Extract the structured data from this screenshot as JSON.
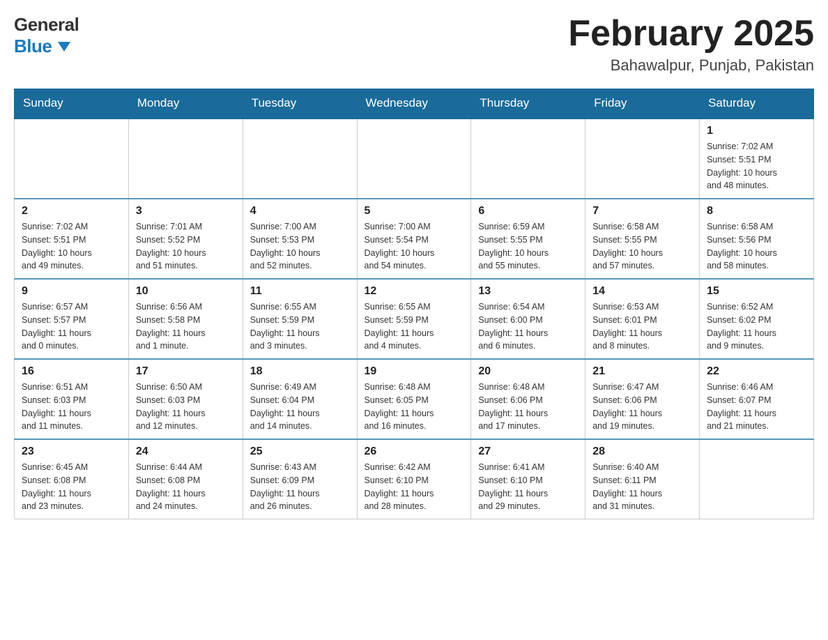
{
  "header": {
    "logo_general": "General",
    "logo_blue": "Blue",
    "month_title": "February 2025",
    "location": "Bahawalpur, Punjab, Pakistan"
  },
  "weekdays": [
    "Sunday",
    "Monday",
    "Tuesday",
    "Wednesday",
    "Thursday",
    "Friday",
    "Saturday"
  ],
  "weeks": [
    {
      "days": [
        {
          "number": "",
          "info": ""
        },
        {
          "number": "",
          "info": ""
        },
        {
          "number": "",
          "info": ""
        },
        {
          "number": "",
          "info": ""
        },
        {
          "number": "",
          "info": ""
        },
        {
          "number": "",
          "info": ""
        },
        {
          "number": "1",
          "info": "Sunrise: 7:02 AM\nSunset: 5:51 PM\nDaylight: 10 hours\nand 48 minutes."
        }
      ]
    },
    {
      "days": [
        {
          "number": "2",
          "info": "Sunrise: 7:02 AM\nSunset: 5:51 PM\nDaylight: 10 hours\nand 49 minutes."
        },
        {
          "number": "3",
          "info": "Sunrise: 7:01 AM\nSunset: 5:52 PM\nDaylight: 10 hours\nand 51 minutes."
        },
        {
          "number": "4",
          "info": "Sunrise: 7:00 AM\nSunset: 5:53 PM\nDaylight: 10 hours\nand 52 minutes."
        },
        {
          "number": "5",
          "info": "Sunrise: 7:00 AM\nSunset: 5:54 PM\nDaylight: 10 hours\nand 54 minutes."
        },
        {
          "number": "6",
          "info": "Sunrise: 6:59 AM\nSunset: 5:55 PM\nDaylight: 10 hours\nand 55 minutes."
        },
        {
          "number": "7",
          "info": "Sunrise: 6:58 AM\nSunset: 5:55 PM\nDaylight: 10 hours\nand 57 minutes."
        },
        {
          "number": "8",
          "info": "Sunrise: 6:58 AM\nSunset: 5:56 PM\nDaylight: 10 hours\nand 58 minutes."
        }
      ]
    },
    {
      "days": [
        {
          "number": "9",
          "info": "Sunrise: 6:57 AM\nSunset: 5:57 PM\nDaylight: 11 hours\nand 0 minutes."
        },
        {
          "number": "10",
          "info": "Sunrise: 6:56 AM\nSunset: 5:58 PM\nDaylight: 11 hours\nand 1 minute."
        },
        {
          "number": "11",
          "info": "Sunrise: 6:55 AM\nSunset: 5:59 PM\nDaylight: 11 hours\nand 3 minutes."
        },
        {
          "number": "12",
          "info": "Sunrise: 6:55 AM\nSunset: 5:59 PM\nDaylight: 11 hours\nand 4 minutes."
        },
        {
          "number": "13",
          "info": "Sunrise: 6:54 AM\nSunset: 6:00 PM\nDaylight: 11 hours\nand 6 minutes."
        },
        {
          "number": "14",
          "info": "Sunrise: 6:53 AM\nSunset: 6:01 PM\nDaylight: 11 hours\nand 8 minutes."
        },
        {
          "number": "15",
          "info": "Sunrise: 6:52 AM\nSunset: 6:02 PM\nDaylight: 11 hours\nand 9 minutes."
        }
      ]
    },
    {
      "days": [
        {
          "number": "16",
          "info": "Sunrise: 6:51 AM\nSunset: 6:03 PM\nDaylight: 11 hours\nand 11 minutes."
        },
        {
          "number": "17",
          "info": "Sunrise: 6:50 AM\nSunset: 6:03 PM\nDaylight: 11 hours\nand 12 minutes."
        },
        {
          "number": "18",
          "info": "Sunrise: 6:49 AM\nSunset: 6:04 PM\nDaylight: 11 hours\nand 14 minutes."
        },
        {
          "number": "19",
          "info": "Sunrise: 6:48 AM\nSunset: 6:05 PM\nDaylight: 11 hours\nand 16 minutes."
        },
        {
          "number": "20",
          "info": "Sunrise: 6:48 AM\nSunset: 6:06 PM\nDaylight: 11 hours\nand 17 minutes."
        },
        {
          "number": "21",
          "info": "Sunrise: 6:47 AM\nSunset: 6:06 PM\nDaylight: 11 hours\nand 19 minutes."
        },
        {
          "number": "22",
          "info": "Sunrise: 6:46 AM\nSunset: 6:07 PM\nDaylight: 11 hours\nand 21 minutes."
        }
      ]
    },
    {
      "days": [
        {
          "number": "23",
          "info": "Sunrise: 6:45 AM\nSunset: 6:08 PM\nDaylight: 11 hours\nand 23 minutes."
        },
        {
          "number": "24",
          "info": "Sunrise: 6:44 AM\nSunset: 6:08 PM\nDaylight: 11 hours\nand 24 minutes."
        },
        {
          "number": "25",
          "info": "Sunrise: 6:43 AM\nSunset: 6:09 PM\nDaylight: 11 hours\nand 26 minutes."
        },
        {
          "number": "26",
          "info": "Sunrise: 6:42 AM\nSunset: 6:10 PM\nDaylight: 11 hours\nand 28 minutes."
        },
        {
          "number": "27",
          "info": "Sunrise: 6:41 AM\nSunset: 6:10 PM\nDaylight: 11 hours\nand 29 minutes."
        },
        {
          "number": "28",
          "info": "Sunrise: 6:40 AM\nSunset: 6:11 PM\nDaylight: 11 hours\nand 31 minutes."
        },
        {
          "number": "",
          "info": ""
        }
      ]
    }
  ]
}
